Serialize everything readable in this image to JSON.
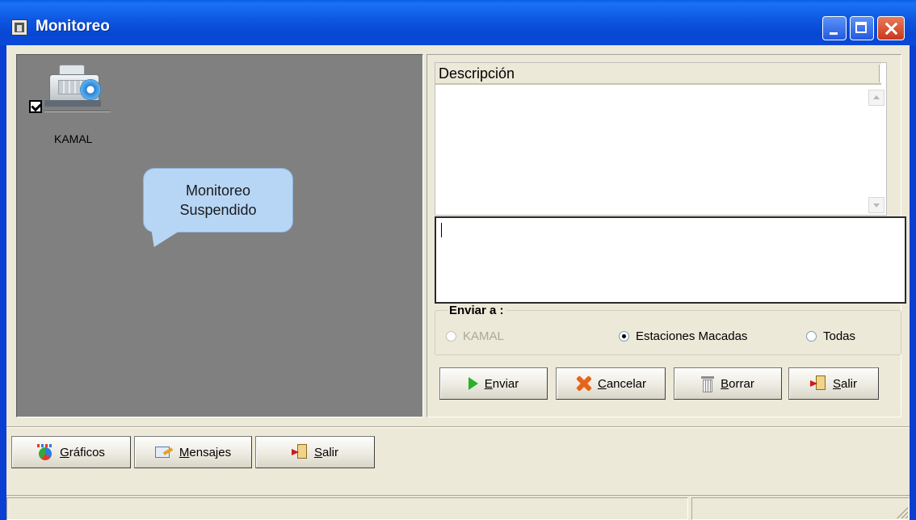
{
  "window": {
    "title": "Monitoreo",
    "icon": "app-icon"
  },
  "stations": [
    {
      "name": "KAMAL",
      "checked": true,
      "icon": "cash-register-icon"
    }
  ],
  "monitor_status": {
    "line1": "Monitoreo",
    "line2": "Suspendido"
  },
  "messages_list": {
    "column_header": "Descripción"
  },
  "send_to": {
    "title": "Enviar a :",
    "options": [
      {
        "label": "KAMAL",
        "selected": false,
        "enabled": false
      },
      {
        "label": "Estaciones Macadas",
        "selected": true,
        "enabled": true
      },
      {
        "label": "Todas",
        "selected": false,
        "enabled": true
      }
    ]
  },
  "action_buttons": {
    "enviar": {
      "key": "E",
      "rest": "nviar",
      "icon": "play-icon"
    },
    "cancelar": {
      "key": "C",
      "rest": "ancelar",
      "icon": "cancel-x-icon"
    },
    "borrar": {
      "key": "B",
      "rest": "orrar",
      "icon": "trash-icon"
    },
    "salir": {
      "key": "S",
      "rest": "alir",
      "icon": "exit-door-icon"
    }
  },
  "bottom_buttons": {
    "graficos": {
      "key": "G",
      "rest": "ráficos",
      "icon": "chart-icon"
    },
    "mensajes": {
      "key": "M",
      "rest": "ensajes",
      "icon": "message-icon"
    },
    "salir": {
      "key": "S",
      "rest": "alir",
      "icon": "exit-door-icon"
    }
  },
  "colors": {
    "titlebar": "#0a56df",
    "panel_gray": "#808080",
    "bubble": "#b7d6f6",
    "face": "#ece9d8"
  }
}
